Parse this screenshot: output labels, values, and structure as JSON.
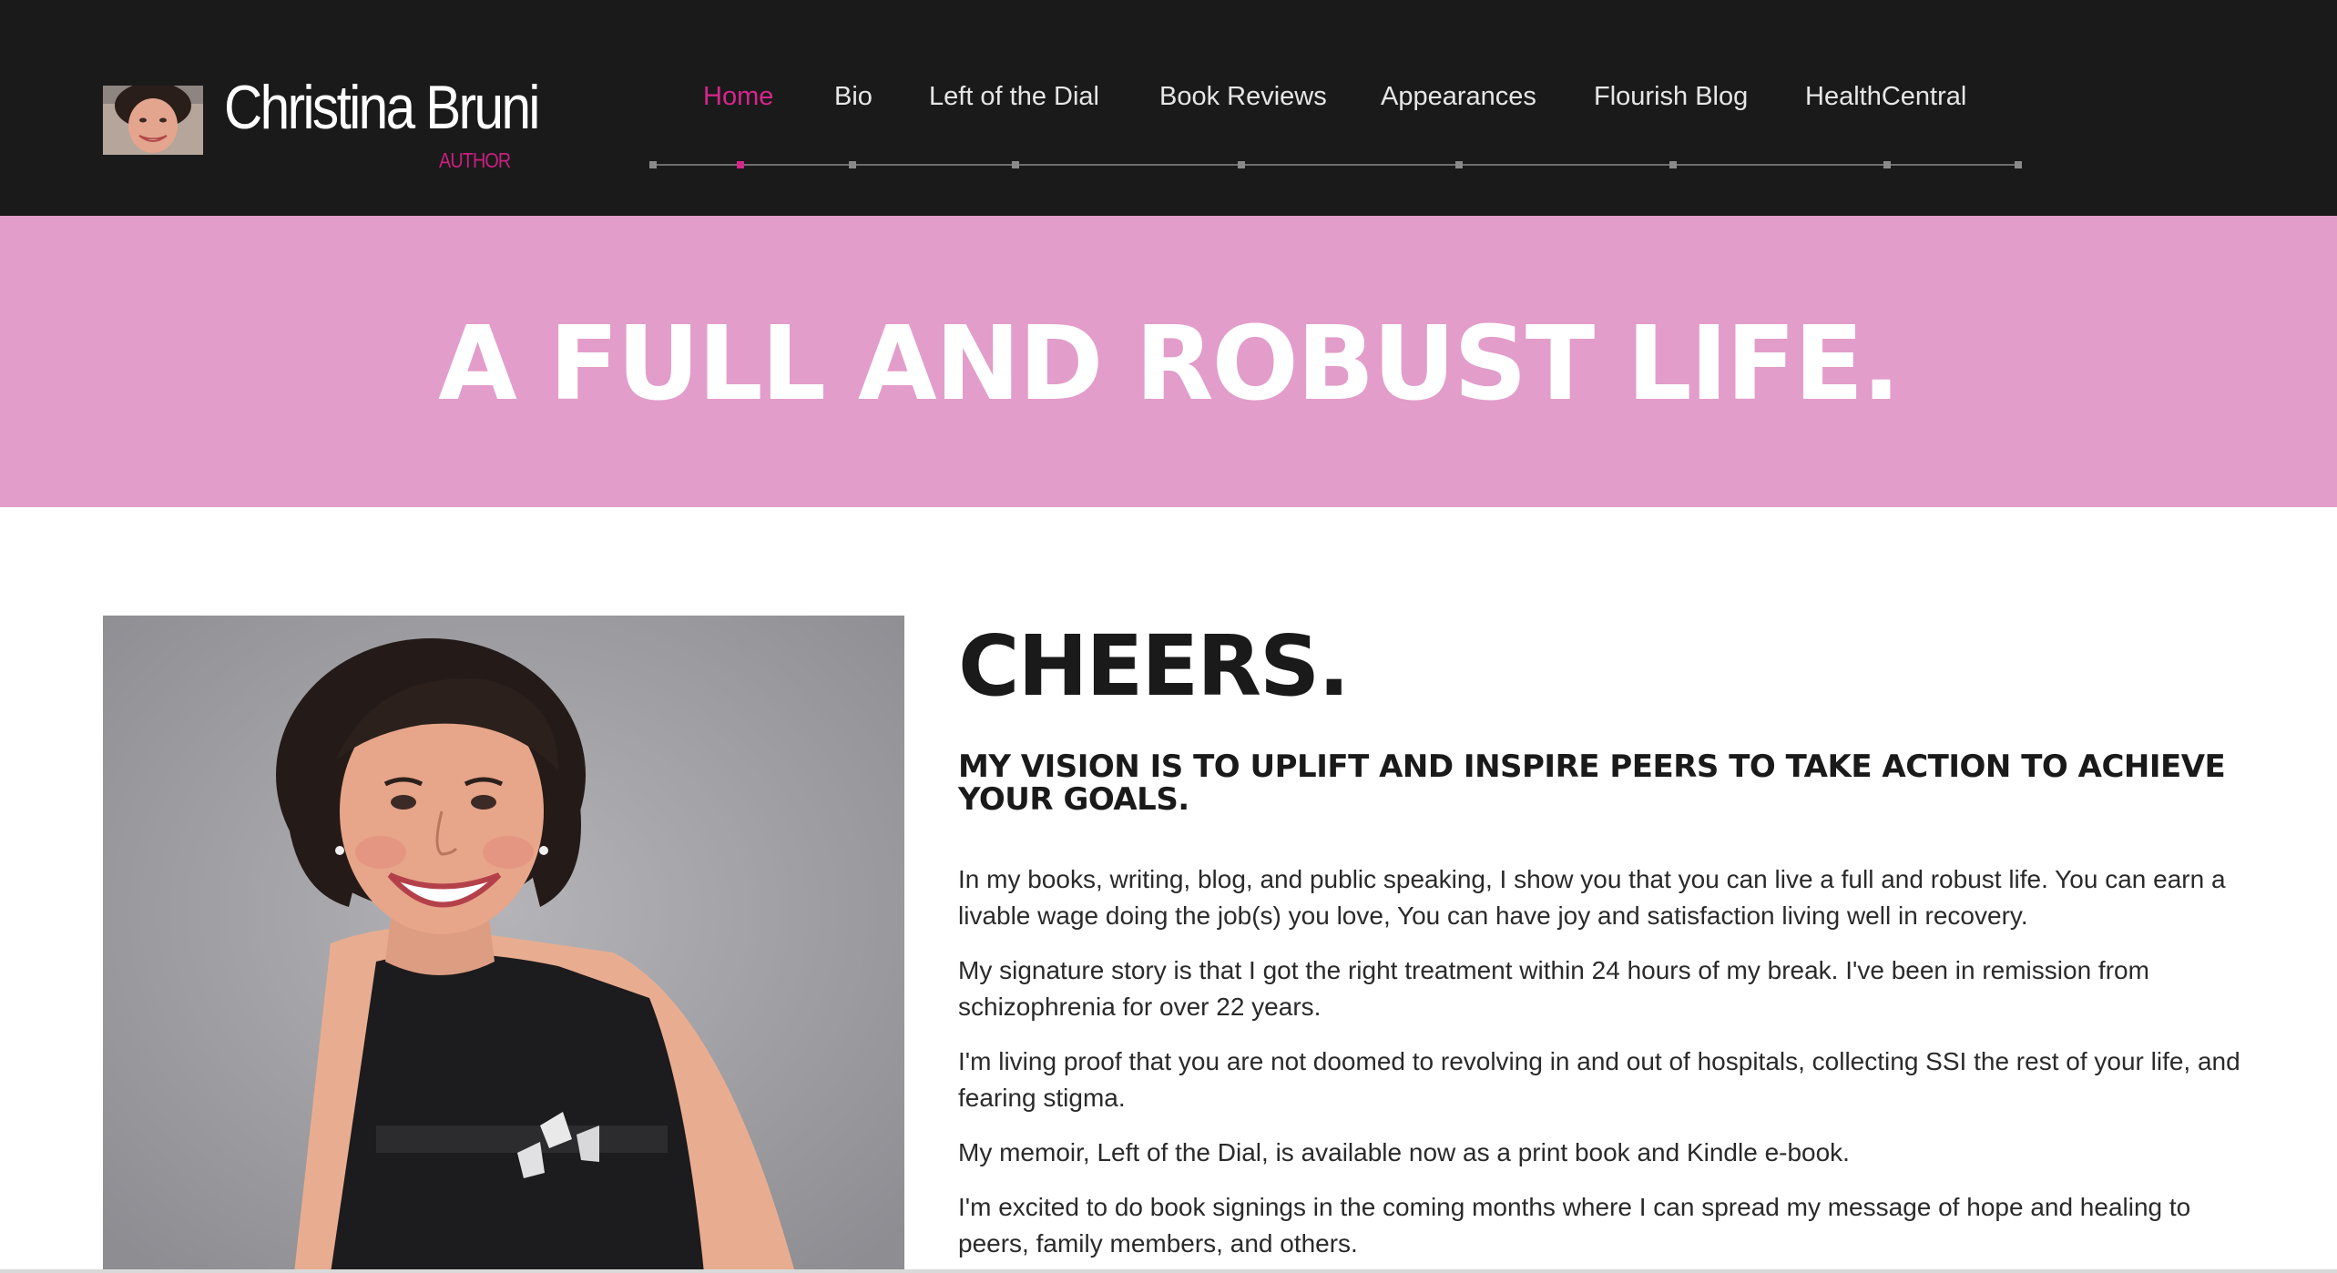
{
  "brand": {
    "name": "Christina Bruni",
    "subtitle": "AUTHOR"
  },
  "nav": {
    "items": [
      {
        "label": "Home",
        "active": true
      },
      {
        "label": "Bio",
        "active": false
      },
      {
        "label": "Left of the Dial",
        "active": false
      },
      {
        "label": "Book Reviews",
        "active": false
      },
      {
        "label": "Appearances",
        "active": false
      },
      {
        "label": "Flourish Blog",
        "active": false
      },
      {
        "label": "HealthCentral",
        "active": false
      }
    ]
  },
  "hero": {
    "title": "A FULL AND ROBUST LIFE."
  },
  "main": {
    "title": "CHEERS.",
    "subtitle": "MY VISION IS TO UPLIFT AND INSPIRE PEERS TO TAKE ACTION TO ACHIEVE YOUR GOALS.",
    "paragraphs": [
      "In my books, writing, blog, and public speaking, I show you that you can live a full and robust life. You can earn a livable wage doing the job(s) you love, You can have joy and satisfaction living well in recovery.",
      "My signature story is that I got the right treatment within 24 hours of my break. I've been in remission from schizophrenia for over 22 years.",
      "I'm living proof that you are not doomed to revolving in and out of hospitals, collecting SSI the rest of your life, and fearing stigma.",
      "My memoir, Left of the Dial, is available now as a print book and Kindle e-book.",
      "I'm excited to do book signings in the coming months where I can spread my message of hope and healing to peers, family members, and others."
    ]
  },
  "colors": {
    "header_bg": "#1b1a1b",
    "accent": "#d6268c",
    "hero_bg": "#e39dca",
    "text": "#2a2a2a"
  }
}
